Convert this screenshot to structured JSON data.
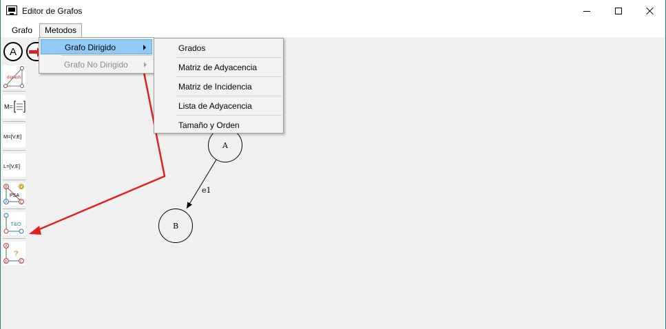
{
  "window": {
    "title": "Editor de Grafos"
  },
  "menubar": {
    "items": [
      "Grafo",
      "Metodos"
    ]
  },
  "toolbar": {
    "node_label": "A"
  },
  "menu_metodos": {
    "items": [
      {
        "label": "Grafo Dirigido",
        "active": true
      },
      {
        "label": "Grafo No Dirigido",
        "disabled": true
      }
    ]
  },
  "submenu_grafo_dirigido": {
    "items": [
      "Grados",
      "Matriz de Adyacencia",
      "Matriz de Incidencia",
      "Lista de Adyacencia",
      "Tamaño y Orden"
    ]
  },
  "sidebar": {
    "tools": [
      {
        "name": "digraph-tool",
        "text": "digraph"
      },
      {
        "name": "adjacency-matrix-tool",
        "text": "M="
      },
      {
        "name": "incidence-matrix-tool",
        "text": "M=[V,E]"
      },
      {
        "name": "adjacency-list-tool",
        "text": "L=[V,E]"
      },
      {
        "name": "psa-tool",
        "text": "PSA",
        "nodes": [
          "B",
          "D",
          "A",
          "C"
        ]
      },
      {
        "name": "size-order-tool",
        "text": "T&O"
      },
      {
        "name": "query-tool",
        "text": "?",
        "nodes": [
          "A",
          "B",
          "C"
        ]
      }
    ]
  },
  "graph": {
    "nodes": [
      "A",
      "B"
    ],
    "edges": [
      {
        "from": "A",
        "to": "B",
        "label": "e1"
      }
    ]
  },
  "colors": {
    "highlight": "#91c9f7",
    "annotation": "#e02020"
  }
}
